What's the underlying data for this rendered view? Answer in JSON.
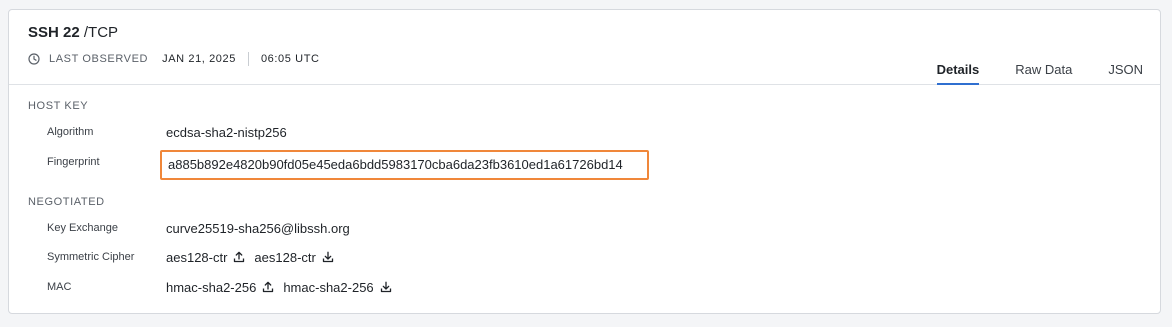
{
  "header": {
    "service": "SSH 22",
    "protocol": "/TCP",
    "last_observed_label": "LAST OBSERVED",
    "date": "JAN 21, 2025",
    "time": "06:05 UTC"
  },
  "tabs": [
    {
      "label": "Details",
      "active": true
    },
    {
      "label": "Raw Data",
      "active": false
    },
    {
      "label": "JSON",
      "active": false
    }
  ],
  "host_key": {
    "title": "HOST KEY",
    "algorithm_label": "Algorithm",
    "algorithm_value": "ecdsa-sha2-nistp256",
    "fingerprint_label": "Fingerprint",
    "fingerprint_value": "a885b892e4820b90fd05e45eda6bdd5983170cba6da23fb3610ed1a61726bd14"
  },
  "negotiated": {
    "title": "NEGOTIATED",
    "key_exchange_label": "Key Exchange",
    "key_exchange_value": "curve25519-sha256@libssh.org",
    "symmetric_cipher_label": "Symmetric Cipher",
    "symmetric_cipher_upload": "aes128-ctr",
    "symmetric_cipher_download": "aes128-ctr",
    "mac_label": "MAC",
    "mac_upload": "hmac-sha2-256",
    "mac_download": "hmac-sha2-256"
  },
  "icons": {
    "clock": "clock-icon",
    "upload": "upload-icon",
    "download": "download-icon"
  },
  "colors": {
    "highlight": "#f0873a",
    "active_tab_underline": "#2f6fd0"
  }
}
